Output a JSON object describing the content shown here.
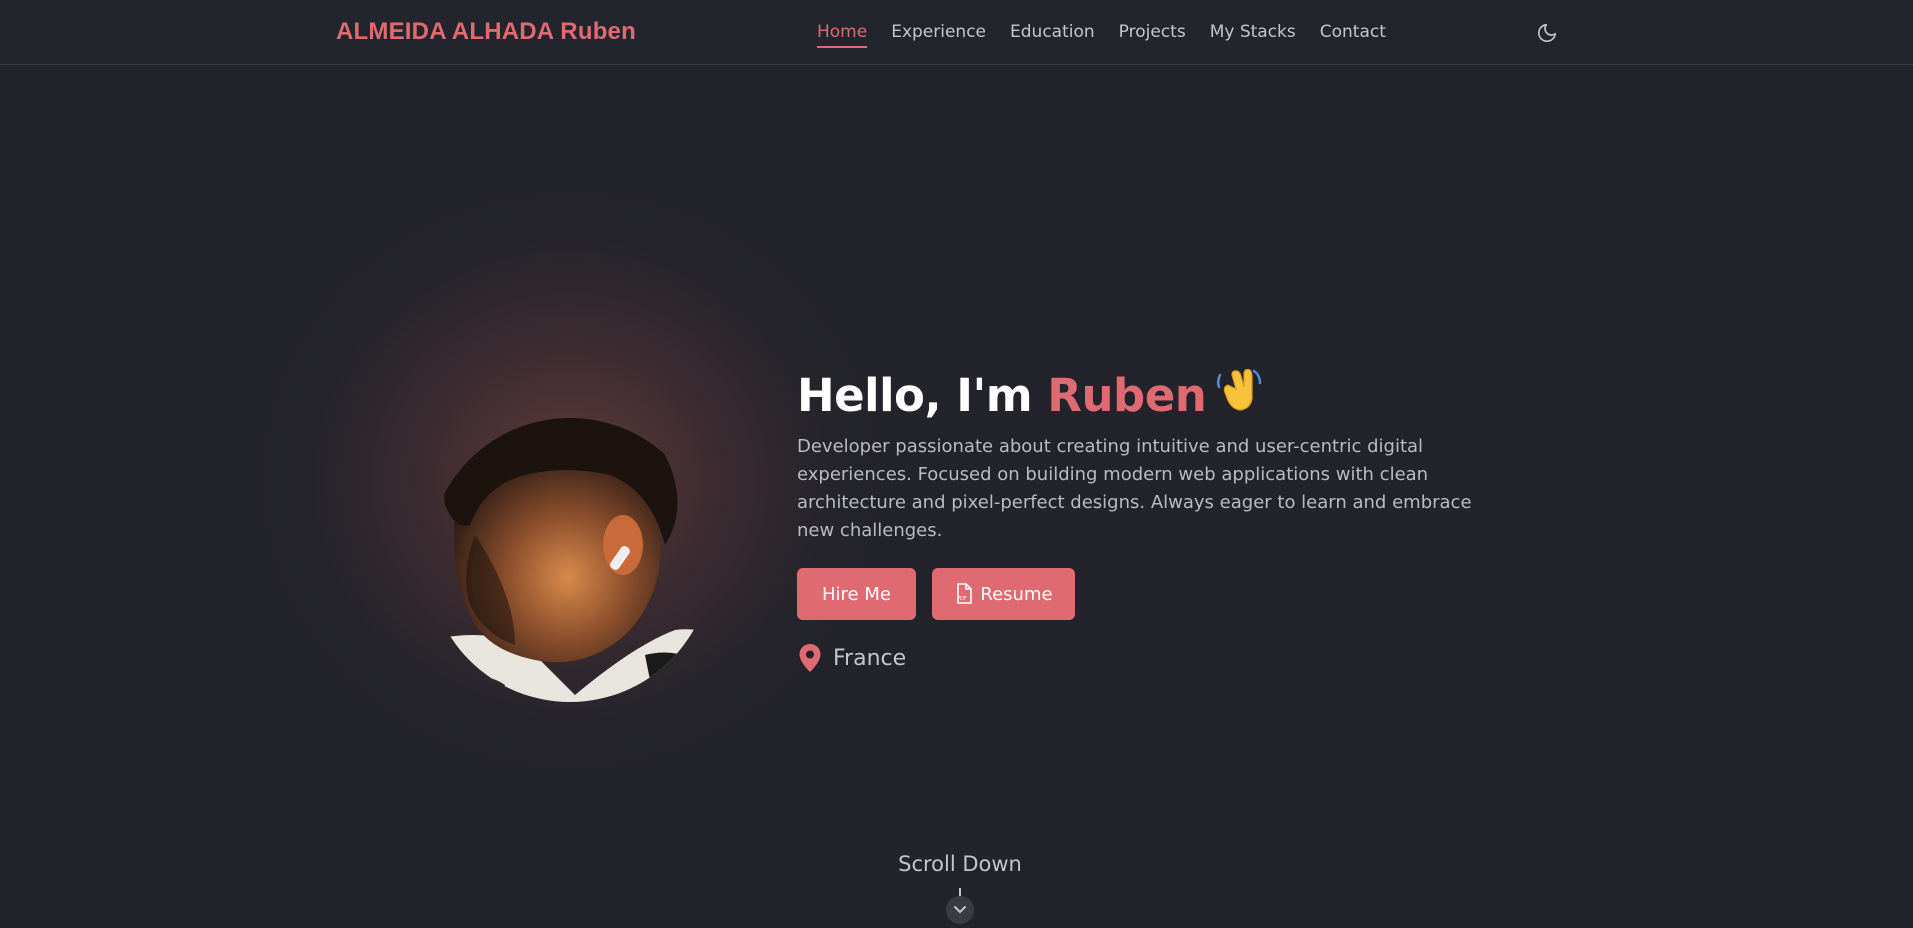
{
  "header": {
    "brand": "ALMEIDA ALHADA Ruben",
    "nav": [
      "Home",
      "Experience",
      "Education",
      "Projects",
      "My Stacks",
      "Contact"
    ],
    "active_nav": "Home",
    "theme_icon": "moon-icon"
  },
  "hero": {
    "greeting_prefix": "Hello, I'm ",
    "name": "Ruben",
    "greeting_emoji_icon": "waving-hand-icon",
    "bio": "Developer passionate about creating intuitive and user-centric digital experiences. Focused on building modern web applications with clean architecture and pixel-perfect designs. Always eager to learn and embrace new challenges.",
    "buttons": {
      "hire": "Hire Me",
      "resume": "Resume",
      "resume_icon": "pdf-file-icon"
    },
    "location": "France",
    "location_icon": "map-pin-icon"
  },
  "scroll": {
    "label": "Scroll Down",
    "icon": "chevron-down-icon"
  },
  "colors": {
    "background": "#22232b",
    "accent": "#e06a72",
    "text": "#c3c6cd"
  }
}
